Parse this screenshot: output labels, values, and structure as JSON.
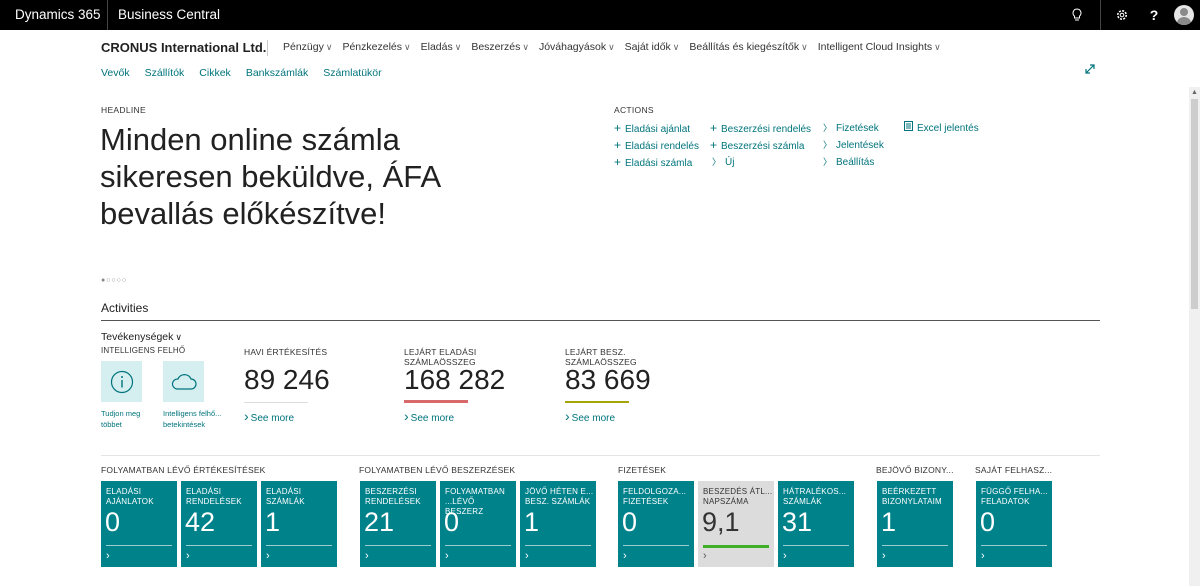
{
  "topbar": {
    "brand": "Dynamics 365",
    "app": "Business Central",
    "icons": [
      "lightbulb-icon",
      "gear-icon",
      "help-icon",
      "avatar"
    ],
    "help_label": "?"
  },
  "company": "CRONUS International Ltd.",
  "main_nav": [
    "Pénzügy",
    "Pénzkezelés",
    "Eladás",
    "Beszerzés",
    "Jóváhagyások",
    "Saját idők",
    "Beállítás és kiegészítők",
    "Intelligent Cloud Insights"
  ],
  "sub_nav": [
    "Vevők",
    "Szállítók",
    "Cikkek",
    "Bankszámlák",
    "Számlatükör"
  ],
  "headline": {
    "label": "HEADLINE",
    "text": "Minden online számla sikeresen beküldve, ÁFA bevallás előkészítve!",
    "pager": "●○○○○"
  },
  "actions": {
    "label": "ACTIONS",
    "col1": [
      "Eladási ajánlat",
      "Eladási rendelés",
      "Eladási számla"
    ],
    "col2": [
      "Beszerzési rendelés",
      "Beszerzési számla",
      "Új"
    ],
    "col3": [
      "Fizetések",
      "Jelentések",
      "Beállítás"
    ],
    "col4": [
      "Excel jelentés"
    ]
  },
  "activities": {
    "title": "Activities",
    "dropdown": "Tevékenységek",
    "intel_label": "INTELLIGENS FELHŐ",
    "intel_items": [
      "Tudjon meg többet",
      "Intelligens felhő... betekintések"
    ],
    "kpis": [
      {
        "label": "HAVI ÉRTÉKESÍTÉS",
        "value": "89 246",
        "more": "See more",
        "bar_color": "#dcdcdc"
      },
      {
        "label": "LEJÁRT ELADÁSI SZÁMLAÖSSZEG",
        "value": "168 282",
        "more": "See more",
        "bar_color": "#d8696b"
      },
      {
        "label": "LEJÁRT BESZ. SZÁMLAÖSSZEG",
        "value": "83 669",
        "more": "See more",
        "bar_color": "#a5a50a"
      }
    ]
  },
  "groups": [
    "FOLYAMATBAN LÉVŐ ÉRTÉKESÍTÉSEK",
    "FOLYAMATBEN LÉVŐ BESZERZÉSEK",
    "FIZETÉSEK",
    "BEJÖVŐ BIZONY...",
    "SAJÁT FELHASZ..."
  ],
  "tiles": [
    {
      "title": "ELADÁSI AJÁNLATOK",
      "value": "0"
    },
    {
      "title": "ELADÁSI RENDELÉSEK",
      "value": "42"
    },
    {
      "title": "ELADÁSI SZÁMLÁK",
      "value": "1"
    },
    {
      "title": "BESZERZÉSI RENDELÉSEK",
      "value": "21"
    },
    {
      "title": "FOLYAMATBAN ...LÉVŐ BESZERZ",
      "value": "0"
    },
    {
      "title": "JÖVŐ HÉTEN E... BESZ. SZÁMLÁK",
      "value": "1"
    },
    {
      "title": "FELDOLGOZA... FIZETÉSEK",
      "value": "0"
    },
    {
      "title": "BESZEDÉS ÁTL... NAPSZÁMA",
      "value": "9,1"
    },
    {
      "title": "HÁTRALÉKOS... SZÁMLÁK",
      "value": "31"
    },
    {
      "title": "BEÉRKEZETT BIZONYLATAIM",
      "value": "1"
    },
    {
      "title": "FÜGGŐ FELHA... FELADATOK",
      "value": "0"
    }
  ],
  "tile_arrow": "›",
  "colors": {
    "teal": "#00828b",
    "link": "#00747c",
    "topbar": "#000000"
  }
}
